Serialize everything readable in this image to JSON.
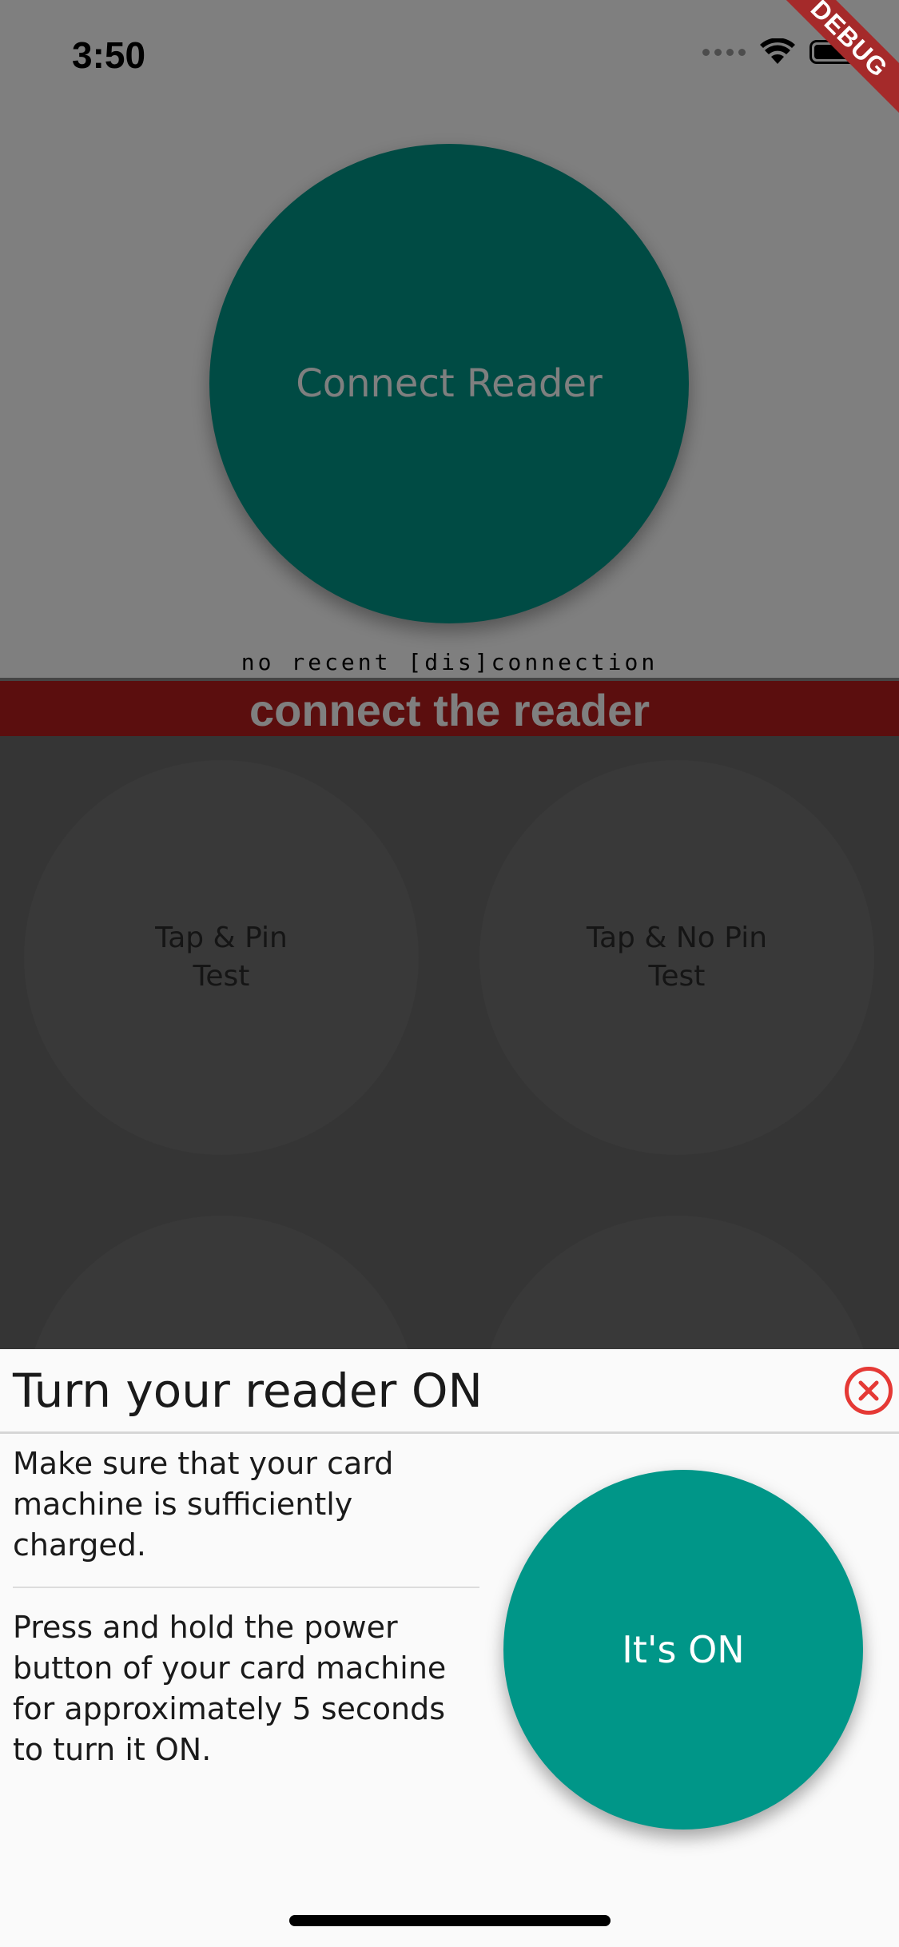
{
  "status_bar": {
    "time": "3:50"
  },
  "debug_banner": "DEBUG",
  "main": {
    "connect_button_label": "Connect Reader",
    "connection_status": "no recent [dis]connection",
    "warning_banner": "connect the reader",
    "test_buttons": [
      {
        "label": "Tap & Pin\nTest"
      },
      {
        "label": "Tap & No Pin\nTest"
      }
    ]
  },
  "sheet": {
    "title": "Turn your reader ON",
    "paragraph_1": "Make sure that your card machine is sufficiently charged.",
    "paragraph_2": "Press and hold the power button of your card machine for approximately 5 seconds to turn it ON.",
    "confirm_button_label": "It's ON"
  },
  "colors": {
    "accent": "#009688",
    "warning": "#b71c1c",
    "close": "#e53935"
  }
}
